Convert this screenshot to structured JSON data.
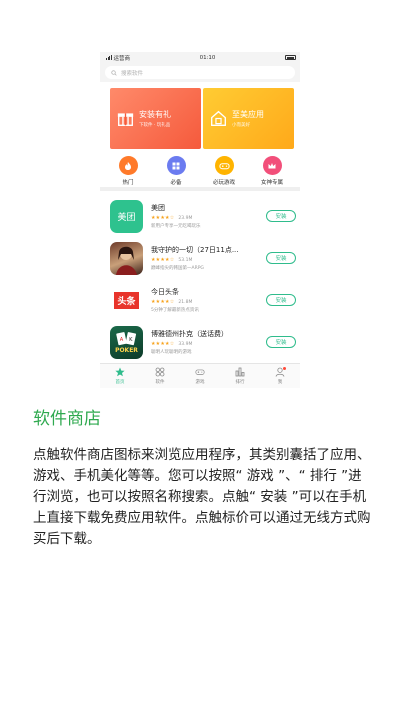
{
  "status_bar": {
    "carrier": "运营商",
    "time": "01:10"
  },
  "search": {
    "placeholder": "搜索软件"
  },
  "banners": [
    {
      "title": "安装有礼",
      "subtitle": "下软件 · 玩礼品",
      "color": "#f55a3c"
    },
    {
      "title": "至美应用",
      "subtitle": "小而美好",
      "color": "#ffa91a"
    }
  ],
  "categories": [
    {
      "label": "热门",
      "icon": "flame-icon",
      "color": "#ff7a2a"
    },
    {
      "label": "必备",
      "icon": "grid-icon",
      "color": "#6b7bf0"
    },
    {
      "label": "必玩游戏",
      "icon": "gamepad-icon",
      "color": "#ffb400"
    },
    {
      "label": "女神专属",
      "icon": "crown-icon",
      "color": "#f24f7a"
    }
  ],
  "apps": [
    {
      "name": "美团",
      "rating_stars": "★★★★☆",
      "size": "23.9M",
      "desc": "新用户专享一元吃喝玩乐",
      "icon_text": "美团",
      "button": "安装"
    },
    {
      "name": "我守护的一切（27日11点...",
      "rating_stars": "★★★★☆",
      "size": "53.1M",
      "desc": "巅峰指尖的韩国第一ARPG",
      "icon_text": "",
      "button": "安装"
    },
    {
      "name": "今日头条",
      "rating_stars": "★★★★☆",
      "size": "21.8M",
      "desc": "5分钟了解最新热点资讯",
      "icon_text": "头条",
      "button": "安装"
    },
    {
      "name": "博雅德州扑克（送话费）",
      "rating_stars": "★★★★☆",
      "size": "33.9M",
      "desc": "聪明人玩聪明的游戏",
      "icon_text": "POKER",
      "button": "安装"
    }
  ],
  "tabs": [
    {
      "label": "首页",
      "icon": "star-icon",
      "active": true
    },
    {
      "label": "软件",
      "icon": "apps-icon",
      "active": false
    },
    {
      "label": "游戏",
      "icon": "gamepad-icon",
      "active": false
    },
    {
      "label": "排行",
      "icon": "ranking-icon",
      "active": false
    },
    {
      "label": "我",
      "icon": "person-icon",
      "active": false
    }
  ],
  "colors": {
    "accent": "#2fbc8c",
    "title_green": "#2fa94f",
    "star": "#f7a21b"
  },
  "description": {
    "title": "软件商店",
    "body": "点触软件商店图标来浏览应用程序，其类别囊括了应用、游戏、手机美化等等。您可以按照“ 游戏 ”、“ 排行 ”进行浏览，也可以按照名称搜索。点触“ 安装 ”可以在手机上直接下载免费应用软件。点触标价可以通过无线方式购买后下载。"
  }
}
